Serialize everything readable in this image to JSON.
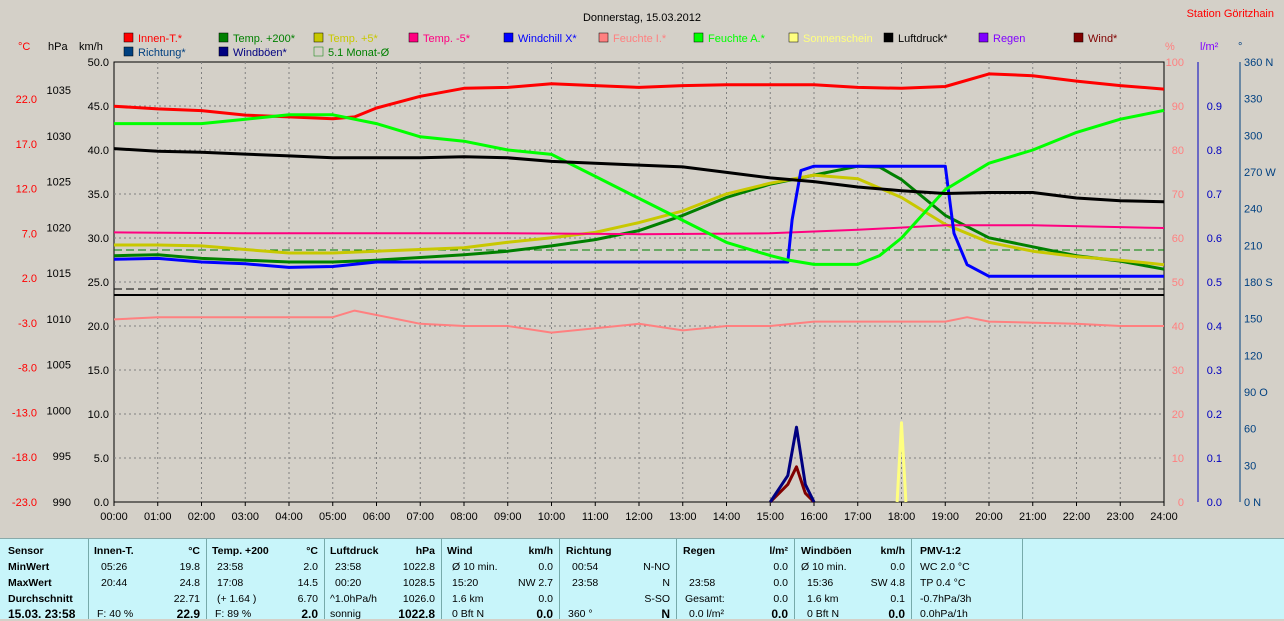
{
  "header": {
    "date": "Donnerstag, 15.03.2012",
    "station": "Station Göritzhain"
  },
  "units": {
    "temp": "°C",
    "pressure": "hPa",
    "speed": "km/h",
    "percent": "%",
    "rain": "l/m²",
    "deg": "°"
  },
  "legend": [
    {
      "label": "Innen-T.*",
      "color": "#ff0000"
    },
    {
      "label": "Temp. +200*",
      "color": "#008000"
    },
    {
      "label": "Temp. +5*",
      "color": "#c8c800"
    },
    {
      "label": "Temp. -5*",
      "color": "#ff0080"
    },
    {
      "label": "Windchill X*",
      "color": "#0000ff"
    },
    {
      "label": "Feuchte I.*",
      "color": "#ff8080"
    },
    {
      "label": "Feuchte A.*",
      "color": "#00ff00"
    },
    {
      "label": "Sonnenschein",
      "color": "#ffff80"
    },
    {
      "label": "Luftdruck*",
      "color": "#000000"
    },
    {
      "label": "Regen",
      "color": "#8000ff"
    },
    {
      "label": "Wind*",
      "color": "#800000"
    },
    {
      "label": "Richtung*",
      "color": "#004080"
    },
    {
      "label": "Windböen*",
      "color": "#000080"
    },
    {
      "label": "5.1 Monat-Ø",
      "color": "#008000"
    }
  ],
  "chart_data": {
    "type": "line",
    "x": [
      "00:00",
      "01:00",
      "02:00",
      "03:00",
      "04:00",
      "05:00",
      "06:00",
      "07:00",
      "08:00",
      "09:00",
      "10:00",
      "11:00",
      "12:00",
      "13:00",
      "14:00",
      "15:00",
      "16:00",
      "17:00",
      "18:00",
      "19:00",
      "20:00",
      "21:00",
      "22:00",
      "23:00",
      "24:00"
    ],
    "axes": {
      "temp_c": [
        "22.0",
        "17.0",
        "12.0",
        "7.0",
        "2.0",
        "-3.0",
        "-8.0",
        "-13.0",
        "-18.0",
        "-23.0"
      ],
      "pressure_hpa": [
        "1035",
        "1030",
        "1025",
        "1020",
        "1015",
        "1010",
        "1005",
        "1000",
        "995",
        "990"
      ],
      "speed_kmh": [
        "50.0",
        "45.0",
        "40.0",
        "35.0",
        "30.0",
        "25.0",
        "20.0",
        "15.0",
        "10.0",
        "5.0",
        "0.0"
      ],
      "percent": [
        "100",
        "90",
        "80",
        "70",
        "60",
        "50",
        "40",
        "30",
        "20",
        "10",
        "0"
      ],
      "rain": [
        "0.9",
        "0.8",
        "0.7",
        "0.6",
        "0.5",
        "0.4",
        "0.3",
        "0.2",
        "0.1",
        "0.0"
      ],
      "direction": [
        "360 N",
        "330",
        "300",
        "270 W",
        "240",
        "210",
        "180 S",
        "150",
        "120",
        "90 O",
        "60",
        "30",
        "0 N"
      ]
    },
    "series": [
      {
        "name": "Innen-T.*",
        "color": "#ff0000",
        "unit": "°C",
        "points": [
          [
            0,
            21.2
          ],
          [
            1,
            20.9
          ],
          [
            2,
            20.7
          ],
          [
            3,
            20.2
          ],
          [
            4,
            20.0
          ],
          [
            5,
            19.8
          ],
          [
            5.5,
            20.0
          ],
          [
            6,
            21.0
          ],
          [
            7,
            22.3
          ],
          [
            8,
            23.2
          ],
          [
            9,
            23.3
          ],
          [
            10,
            23.7
          ],
          [
            11,
            23.5
          ],
          [
            12,
            23.3
          ],
          [
            13,
            23.5
          ],
          [
            14,
            23.6
          ],
          [
            15,
            23.6
          ],
          [
            16,
            23.6
          ],
          [
            17,
            23.3
          ],
          [
            18,
            23.2
          ],
          [
            19,
            23.4
          ],
          [
            20,
            24.8
          ],
          [
            21,
            24.6
          ],
          [
            22,
            24.0
          ],
          [
            23,
            23.5
          ],
          [
            24,
            23.1
          ]
        ]
      },
      {
        "name": "Temp. +200*",
        "color": "#008000",
        "unit": "°C",
        "points": [
          [
            0,
            4.5
          ],
          [
            1,
            4.6
          ],
          [
            2,
            4.2
          ],
          [
            3,
            4.0
          ],
          [
            4,
            3.8
          ],
          [
            5,
            3.8
          ],
          [
            6,
            4.0
          ],
          [
            7,
            4.3
          ],
          [
            8,
            4.6
          ],
          [
            9,
            5.0
          ],
          [
            10,
            5.6
          ],
          [
            11,
            6.3
          ],
          [
            12,
            7.3
          ],
          [
            13,
            9.0
          ],
          [
            14,
            11.0
          ],
          [
            15,
            12.5
          ],
          [
            16,
            13.5
          ],
          [
            17,
            14.5
          ],
          [
            17.5,
            14.4
          ],
          [
            18,
            13.0
          ],
          [
            19,
            9.0
          ],
          [
            20,
            6.5
          ],
          [
            21,
            5.5
          ],
          [
            22,
            4.5
          ],
          [
            23,
            3.9
          ],
          [
            24,
            3.0
          ]
        ]
      },
      {
        "name": "Temp. +5*",
        "color": "#c8c800",
        "unit": "°C",
        "points": [
          [
            0,
            5.7
          ],
          [
            1,
            5.7
          ],
          [
            2,
            5.6
          ],
          [
            3,
            5.2
          ],
          [
            4,
            4.8
          ],
          [
            5,
            4.8
          ],
          [
            6,
            5.0
          ],
          [
            7,
            5.2
          ],
          [
            8,
            5.4
          ],
          [
            9,
            6.0
          ],
          [
            10,
            6.5
          ],
          [
            11,
            7.1
          ],
          [
            12,
            8.2
          ],
          [
            13,
            9.5
          ],
          [
            14,
            11.4
          ],
          [
            15,
            12.6
          ],
          [
            16,
            13.5
          ],
          [
            17,
            13.1
          ],
          [
            18,
            11.0
          ],
          [
            19,
            8.0
          ],
          [
            20,
            6.0
          ],
          [
            21,
            5.0
          ],
          [
            22,
            4.4
          ],
          [
            23,
            4.0
          ],
          [
            24,
            3.5
          ]
        ]
      },
      {
        "name": "Temp. -5*",
        "color": "#ff0080",
        "unit": "°C",
        "points": [
          [
            0,
            7.1
          ],
          [
            3,
            7.0
          ],
          [
            6,
            7.0
          ],
          [
            9,
            7.0
          ],
          [
            12,
            6.9
          ],
          [
            15,
            7.0
          ],
          [
            17,
            7.4
          ],
          [
            19,
            7.9
          ],
          [
            21,
            7.9
          ],
          [
            24,
            7.6
          ]
        ]
      },
      {
        "name": "Windchill X*",
        "color": "#0000ff",
        "unit": "°C",
        "points": [
          [
            0,
            4.1
          ],
          [
            1,
            4.2
          ],
          [
            2,
            3.8
          ],
          [
            3,
            3.6
          ],
          [
            4,
            3.2
          ],
          [
            5,
            3.3
          ],
          [
            6,
            3.8
          ],
          [
            7,
            3.8
          ],
          [
            8,
            3.8
          ],
          [
            9,
            3.8
          ],
          [
            10,
            3.8
          ],
          [
            11,
            3.8
          ],
          [
            12,
            3.8
          ],
          [
            13,
            3.8
          ],
          [
            14,
            3.8
          ],
          [
            15.4,
            3.8
          ],
          [
            15.5,
            8.5
          ],
          [
            15.7,
            14.0
          ],
          [
            16,
            14.5
          ],
          [
            17,
            14.5
          ],
          [
            18,
            14.5
          ],
          [
            19,
            14.5
          ],
          [
            19.2,
            7.0
          ],
          [
            19.5,
            3.5
          ],
          [
            20,
            2.2
          ],
          [
            22,
            2.2
          ],
          [
            24,
            2.2
          ]
        ]
      },
      {
        "name": "Feuchte I.*",
        "color": "#ff8080",
        "unit": "%",
        "points": [
          [
            0,
            41.5
          ],
          [
            1,
            42
          ],
          [
            2,
            42
          ],
          [
            3,
            42
          ],
          [
            4,
            42
          ],
          [
            5,
            42
          ],
          [
            5.5,
            43.5
          ],
          [
            6,
            42.5
          ],
          [
            6.5,
            41.5
          ],
          [
            7,
            40.5
          ],
          [
            8,
            40
          ],
          [
            9,
            40
          ],
          [
            10,
            38.5
          ],
          [
            11,
            39.5
          ],
          [
            12,
            40.5
          ],
          [
            13,
            39
          ],
          [
            14,
            40
          ],
          [
            15,
            40
          ],
          [
            16,
            41
          ],
          [
            17,
            41
          ],
          [
            18,
            41
          ],
          [
            19,
            41
          ],
          [
            19.5,
            42
          ],
          [
            20,
            41
          ],
          [
            22,
            40.5
          ],
          [
            23,
            40
          ],
          [
            24,
            40
          ]
        ]
      },
      {
        "name": "Feuchte A.*",
        "color": "#00ff00",
        "unit": "%",
        "points": [
          [
            0,
            86
          ],
          [
            1,
            86
          ],
          [
            2,
            86
          ],
          [
            3,
            87
          ],
          [
            4,
            88
          ],
          [
            5,
            88
          ],
          [
            6,
            86
          ],
          [
            7,
            83
          ],
          [
            8,
            82
          ],
          [
            9,
            80
          ],
          [
            10,
            79
          ],
          [
            11,
            74
          ],
          [
            12,
            69
          ],
          [
            13,
            64
          ],
          [
            14,
            59
          ],
          [
            15,
            56
          ],
          [
            15.4,
            55
          ],
          [
            16,
            54
          ],
          [
            17,
            54
          ],
          [
            17.5,
            56
          ],
          [
            18,
            60
          ],
          [
            19,
            71
          ],
          [
            20,
            77
          ],
          [
            21,
            80
          ],
          [
            22,
            84
          ],
          [
            23,
            87
          ],
          [
            24,
            89
          ]
        ]
      },
      {
        "name": "Luftdruck*",
        "color": "#000000",
        "unit": "hPa",
        "points": [
          [
            0,
            1028.6
          ],
          [
            1,
            1028.3
          ],
          [
            2,
            1028.2
          ],
          [
            3,
            1028.0
          ],
          [
            4,
            1027.8
          ],
          [
            5,
            1027.6
          ],
          [
            6,
            1027.6
          ],
          [
            7,
            1027.6
          ],
          [
            8,
            1027.7
          ],
          [
            9,
            1027.6
          ],
          [
            10,
            1027.2
          ],
          [
            11,
            1027.0
          ],
          [
            12,
            1026.8
          ],
          [
            13,
            1026.6
          ],
          [
            14,
            1026.0
          ],
          [
            15,
            1025.4
          ],
          [
            16,
            1025.0
          ],
          [
            17,
            1024.4
          ],
          [
            18,
            1024.0
          ],
          [
            19,
            1023.7
          ],
          [
            20,
            1023.8
          ],
          [
            21,
            1023.8
          ],
          [
            22,
            1023.2
          ],
          [
            23,
            1022.9
          ],
          [
            24,
            1022.8
          ]
        ]
      },
      {
        "name": "Sonnenschein",
        "color": "#ffff80",
        "unit": "%",
        "points": [
          [
            17.9,
            0
          ],
          [
            18,
            18
          ],
          [
            18.1,
            0
          ]
        ]
      },
      {
        "name": "Wind*",
        "color": "#800000",
        "unit": "km/h",
        "points": [
          [
            15,
            0
          ],
          [
            15.4,
            2
          ],
          [
            15.6,
            4
          ],
          [
            15.8,
            1
          ],
          [
            16,
            0
          ]
        ]
      },
      {
        "name": "Windböen*",
        "color": "#000080",
        "unit": "km/h",
        "points": [
          [
            15,
            0
          ],
          [
            15.4,
            3
          ],
          [
            15.6,
            8.5
          ],
          [
            15.8,
            2
          ],
          [
            16,
            0
          ]
        ]
      }
    ]
  },
  "stats": {
    "sensor": {
      "title": "Sensor",
      "rows": [
        "MinWert",
        "MaxWert",
        "Durchschnitt",
        "15.03. 23:58"
      ]
    },
    "innen": {
      "title": "Innen-T.",
      "unit": "°C",
      "rows": [
        [
          "05:26",
          "19.8"
        ],
        [
          "20:44",
          "24.8"
        ],
        [
          "",
          "22.71"
        ],
        [
          "F: 40 %",
          "22.9"
        ]
      ]
    },
    "temp200": {
      "title": "Temp. +200",
      "unit": "°C",
      "rows": [
        [
          "23:58",
          "2.0"
        ],
        [
          "17:08",
          "14.5"
        ],
        [
          "(+ 1.64 )",
          "6.70"
        ],
        [
          "F: 89 %",
          "2.0"
        ]
      ]
    },
    "druck": {
      "title": "Luftdruck",
      "unit": "hPa",
      "rows": [
        [
          "23:58",
          "1022.8"
        ],
        [
          "00:20",
          "1028.5"
        ],
        [
          "^1.0hPa/h",
          "1026.0"
        ],
        [
          "sonnig",
          "1022.8"
        ]
      ]
    },
    "wind": {
      "title": "Wind",
      "unit": "km/h",
      "rows": [
        [
          "Ø 10 min.",
          "0.0"
        ],
        [
          "15:20",
          "NW 2.7"
        ],
        [
          "1.6 km",
          "0.0"
        ],
        [
          "0 Bft N",
          "0.0"
        ]
      ]
    },
    "richtung": {
      "title": "Richtung",
      "rows": [
        [
          "00:54",
          "N-NO"
        ],
        [
          "23:58",
          "N"
        ],
        [
          "",
          "S-SO"
        ],
        [
          "360 °",
          "N"
        ]
      ]
    },
    "regen": {
      "title": "Regen",
      "unit": "l/m²",
      "rows": [
        [
          "",
          "0.0"
        ],
        [
          "23:58",
          "0.0"
        ],
        [
          "Gesamt:",
          "0.0"
        ],
        [
          "0.0 l/m²",
          "0.0"
        ]
      ]
    },
    "boeen": {
      "title": "Windböen",
      "unit": "km/h",
      "rows": [
        [
          "Ø 10 min.",
          "0.0"
        ],
        [
          "15:36",
          "SW 4.8"
        ],
        [
          "1.6 km",
          "0.1"
        ],
        [
          "0 Bft N",
          "0.0"
        ]
      ]
    },
    "pmv": {
      "title": "PMV-1:2",
      "rows": [
        "WC 2.0 °C",
        "TP 0.4 °C",
        "-0.7hPa/3h",
        "0.0hPa/1h"
      ]
    }
  }
}
